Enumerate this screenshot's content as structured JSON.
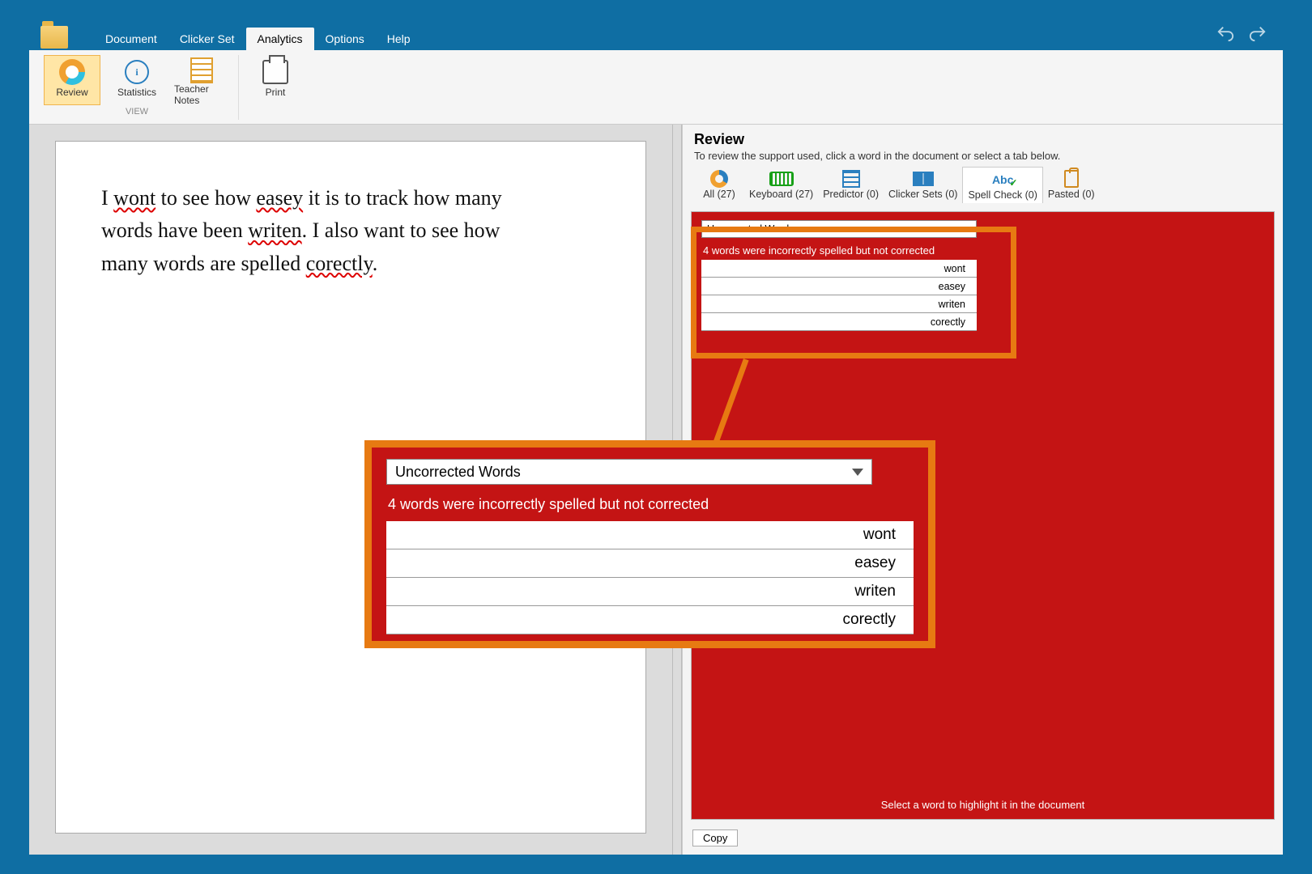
{
  "menu": {
    "tabs": [
      "Document",
      "Clicker Set",
      "Analytics",
      "Options",
      "Help"
    ],
    "active_index": 2
  },
  "ribbon": {
    "groups": [
      {
        "label": "VIEW",
        "items": [
          {
            "id": "review-button",
            "label": "Review",
            "selected": true,
            "icon": "donut"
          },
          {
            "id": "statistics-button",
            "label": "Statistics",
            "icon": "info"
          },
          {
            "id": "teacher-notes-button",
            "label": "Teacher Notes",
            "icon": "notes"
          }
        ]
      },
      {
        "label": "",
        "items": [
          {
            "id": "print-button",
            "label": "Print",
            "icon": "print"
          }
        ]
      }
    ]
  },
  "document_text": {
    "line1_a": "I ",
    "w1": "wont",
    "line1_b": " to see how ",
    "w2": "easey",
    "line1_c": " it is to track how many",
    "line2_a": "words have been ",
    "w3": "writen",
    "line2_b": ". I also want to see how",
    "line3_a": "many words are spelled ",
    "w4": "corectly",
    "line3_b": "."
  },
  "review": {
    "title": "Review",
    "subtitle": "To review the support used, click a word in the document or select a tab below.",
    "tabs": [
      {
        "label": "All (27)",
        "icon": "donut"
      },
      {
        "label": "Keyboard (27)",
        "icon": "kbd"
      },
      {
        "label": "Predictor (0)",
        "icon": "pred"
      },
      {
        "label": "Clicker Sets (0)",
        "icon": "cs"
      },
      {
        "label": "Spell Check (0)",
        "icon": "abc",
        "active": true
      },
      {
        "label": "Pasted (0)",
        "icon": "clip"
      }
    ],
    "dropdown_label": "Uncorrected Words",
    "status": "4 words were incorrectly spelled but not corrected",
    "words": [
      "wont",
      "easey",
      "writen",
      "corectly"
    ],
    "hint": "Select a word to highlight it in the document",
    "copy_label": "Copy"
  }
}
